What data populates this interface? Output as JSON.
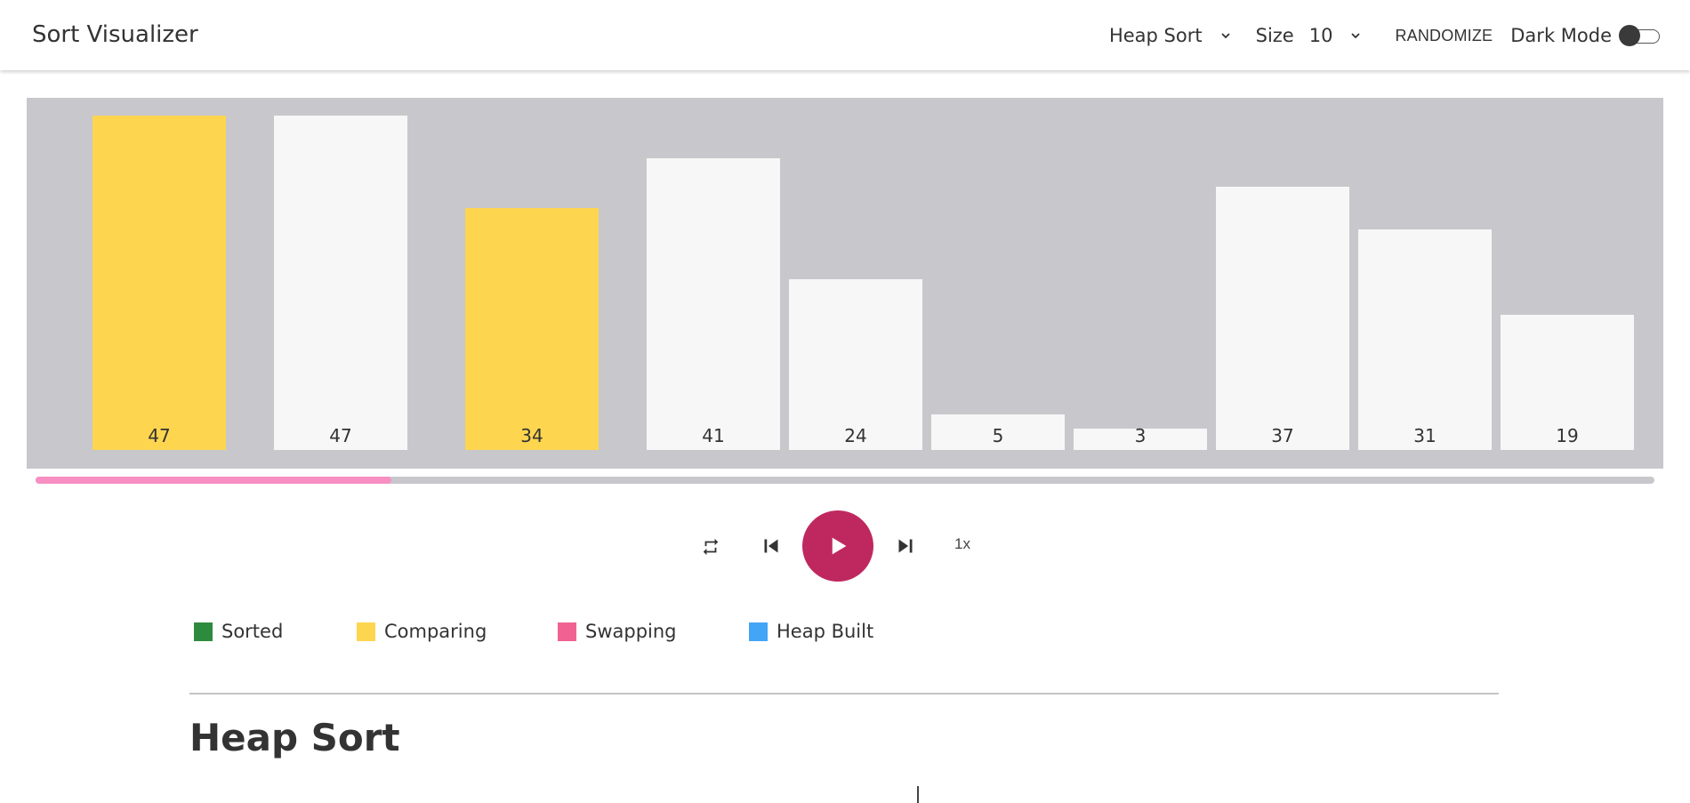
{
  "app": {
    "title": "Sort Visualizer"
  },
  "header": {
    "algorithm": "Heap Sort",
    "size_label": "Size",
    "size_value": "10",
    "randomize_label": "RANDOMIZE",
    "dark_mode_label": "Dark Mode",
    "dark_mode_on": false
  },
  "colors": {
    "sorted": "#2e8b3e",
    "comparing": "#fed54f",
    "swapping": "#f06292",
    "heap_built": "#42a5f5",
    "default_bar": "#f7f7f7",
    "chart_background": "#c8c7cc",
    "progress": "#f78fc3",
    "play": "#bf285f"
  },
  "chart_data": {
    "type": "bar",
    "categories": [
      "47",
      "47",
      "34",
      "41",
      "24",
      "5",
      "3",
      "37",
      "31",
      "19"
    ],
    "values": [
      47,
      47,
      34,
      41,
      24,
      5,
      3,
      37,
      31,
      19
    ],
    "states": [
      "comparing",
      "default",
      "comparing",
      "default",
      "default",
      "default",
      "default",
      "default",
      "default",
      "default"
    ],
    "ylim": [
      0,
      47
    ]
  },
  "playback": {
    "progress": 0.22,
    "speed": "1x"
  },
  "legend": [
    {
      "label": "Sorted",
      "color": "#2e8b3e"
    },
    {
      "label": "Comparing",
      "color": "#fed54f"
    },
    {
      "label": "Swapping",
      "color": "#f06292"
    },
    {
      "label": "Heap Built",
      "color": "#42a5f5"
    }
  ],
  "section": {
    "title": "Heap Sort"
  }
}
